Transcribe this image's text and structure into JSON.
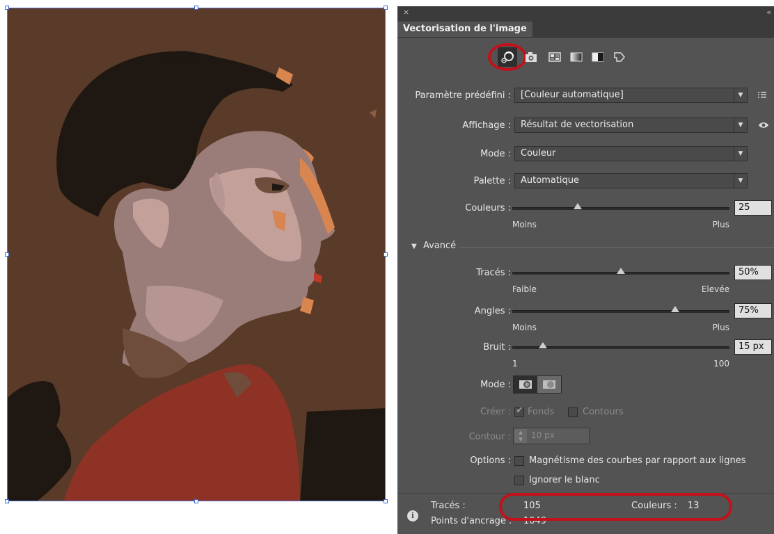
{
  "panel": {
    "tab_label": "Vectorisation de l'image",
    "close_glyph": "×",
    "collapse_glyph": "«",
    "preset": {
      "label": "Paramètre prédéfini :",
      "value": "[Couleur automatique]"
    },
    "view": {
      "label": "Affichage :",
      "value": "Résultat de vectorisation"
    },
    "mode": {
      "label": "Mode :",
      "value": "Couleur"
    },
    "palette": {
      "label": "Palette :",
      "value": "Automatique"
    },
    "colors": {
      "label": "Couleurs :",
      "value": "25",
      "min_label": "Moins",
      "max_label": "Plus",
      "level": 0.3
    },
    "advanced": {
      "label": "Avancé"
    },
    "paths": {
      "label": "Tracés :",
      "value": "50%",
      "min_label": "Faible",
      "max_label": "Elevée",
      "level": 0.5
    },
    "corners": {
      "label": "Angles :",
      "value": "75%",
      "min_label": "Moins",
      "max_label": "Plus",
      "level": 0.75
    },
    "noise": {
      "label": "Bruit :",
      "value": "15 px",
      "min_label": "1",
      "max_label": "100",
      "level": 0.14
    },
    "method_label": "Mode :",
    "create": {
      "label": "Créer :",
      "fills_label": "Fonds",
      "strokes_label": "Contours",
      "fills_checked": true,
      "strokes_checked": false
    },
    "stroke": {
      "label": "Contour :",
      "value": "10 px"
    },
    "options": {
      "label": "Options :",
      "snap_label": "Magnétisme des courbes par rapport aux lignes",
      "ignore_white_label": "Ignorer le blanc",
      "snap_checked": false,
      "ignore_white_checked": false
    },
    "info": {
      "paths_label": "Tracés :",
      "paths_value": "105",
      "colors_label": "Couleurs :",
      "colors_value": "13",
      "anchors_label": "Points d'ancrage :",
      "anchors_value": "1049"
    },
    "icons": [
      "auto-color-icon",
      "high-color-icon",
      "low-color-icon",
      "grayscale-icon",
      "black-white-icon",
      "outline-icon",
      "preset-menu-icon",
      "eye-icon",
      "info-icon",
      "advanced-triangle-icon"
    ],
    "colors_theme": {
      "panel_bg": "#535353",
      "highlight": "#c2111a",
      "field_bg": "#4a4a4a"
    }
  },
  "artwork": {
    "palette": [
      "#5a3a28",
      "#1e1712",
      "#9a7d78",
      "#c4a09a",
      "#b79592",
      "#6e4d3c",
      "#d88550",
      "#8f3226",
      "#8b5e44"
    ]
  }
}
